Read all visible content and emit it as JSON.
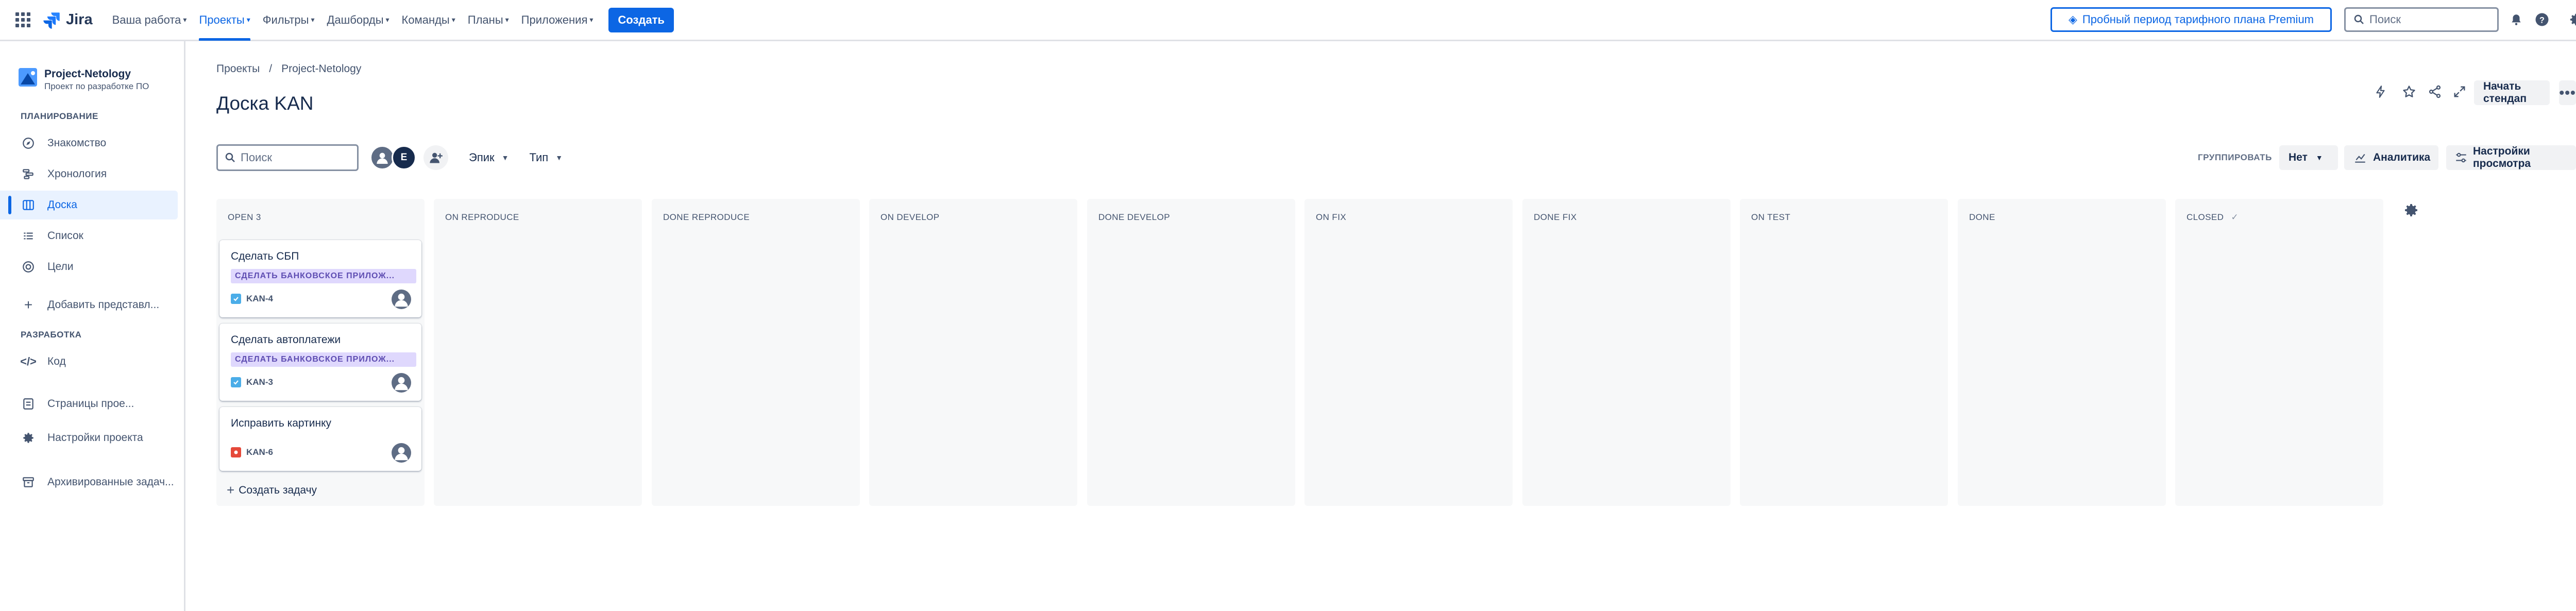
{
  "topnav": {
    "logo_text": "Jira",
    "items": [
      {
        "label": "Ваша работа"
      },
      {
        "label": "Проекты"
      },
      {
        "label": "Фильтры"
      },
      {
        "label": "Дашборды"
      },
      {
        "label": "Команды"
      },
      {
        "label": "Планы"
      },
      {
        "label": "Приложения"
      }
    ],
    "create_label": "Создать",
    "premium_label": "Пробный период тарифного плана Premium",
    "search_placeholder": "Поиск",
    "avatar_initial": "E"
  },
  "sidebar": {
    "project_name": "Project-Netology",
    "project_sub": "Проект по разработке ПО",
    "section_planning": "ПЛАНИРОВАНИЕ",
    "section_dev": "РАЗРАБОТКА",
    "items": [
      {
        "label": "Знакомство",
        "icon": "compass-icon"
      },
      {
        "label": "Хронология",
        "icon": "timeline-icon"
      },
      {
        "label": "Доска",
        "icon": "board-icon"
      },
      {
        "label": "Список",
        "icon": "list-icon"
      },
      {
        "label": "Цели",
        "icon": "goal-icon"
      },
      {
        "label": "Добавить представл...",
        "icon": "plus-icon"
      },
      {
        "label": "Код",
        "icon": "code-icon"
      },
      {
        "label": "Страницы прое...",
        "icon": "pages-icon"
      },
      {
        "label": "Настройки проекта",
        "icon": "gear-icon"
      },
      {
        "label": "Архивированные задач...",
        "icon": "archive-icon"
      }
    ]
  },
  "main": {
    "breadcrumb": [
      "Проекты",
      "Project-Netology"
    ],
    "title": "Доска KAN",
    "start_standup": "Начать стендап",
    "search_placeholder": "Поиск",
    "avatar_initial": "E",
    "filter_epic": "Эпик",
    "filter_type": "Тип",
    "group_label": "ГРУППИРОВАТЬ",
    "group_value": "Нет",
    "analytics_label": "Аналитика",
    "view_settings_label": "Настройки просмотра"
  },
  "board": {
    "columns": [
      {
        "title": "OPEN 3"
      },
      {
        "title": "ON REPRODUCE"
      },
      {
        "title": "DONE REPRODUCE"
      },
      {
        "title": "ON DEVELOP"
      },
      {
        "title": "DONE DEVELOP"
      },
      {
        "title": "ON FIX"
      },
      {
        "title": "DONE FIX"
      },
      {
        "title": "ON TEST"
      },
      {
        "title": "DONE"
      },
      {
        "title": "CLOSED"
      }
    ],
    "cards": [
      {
        "title": "Сделать СБП",
        "epic": "СДЕЛАТЬ БАНКОВСКОЕ ПРИЛОЖ...",
        "key": "KAN-4",
        "type": "task"
      },
      {
        "title": "Сделать автоплатежи",
        "epic": "СДЕЛАТЬ БАНКОВСКОЕ ПРИЛОЖ...",
        "key": "KAN-3",
        "type": "task"
      },
      {
        "title": "Исправить картинку",
        "epic": "",
        "key": "KAN-6",
        "type": "bug"
      }
    ],
    "create_task_label": "Создать задачу"
  },
  "colors": {
    "accent": "#0c66e4",
    "column_bg": "#f7f8f9",
    "epic_bg": "#dfd8fd",
    "epic_text": "#5e4db2",
    "task_icon": "#4bade8",
    "bug_icon": "#e5493a"
  }
}
